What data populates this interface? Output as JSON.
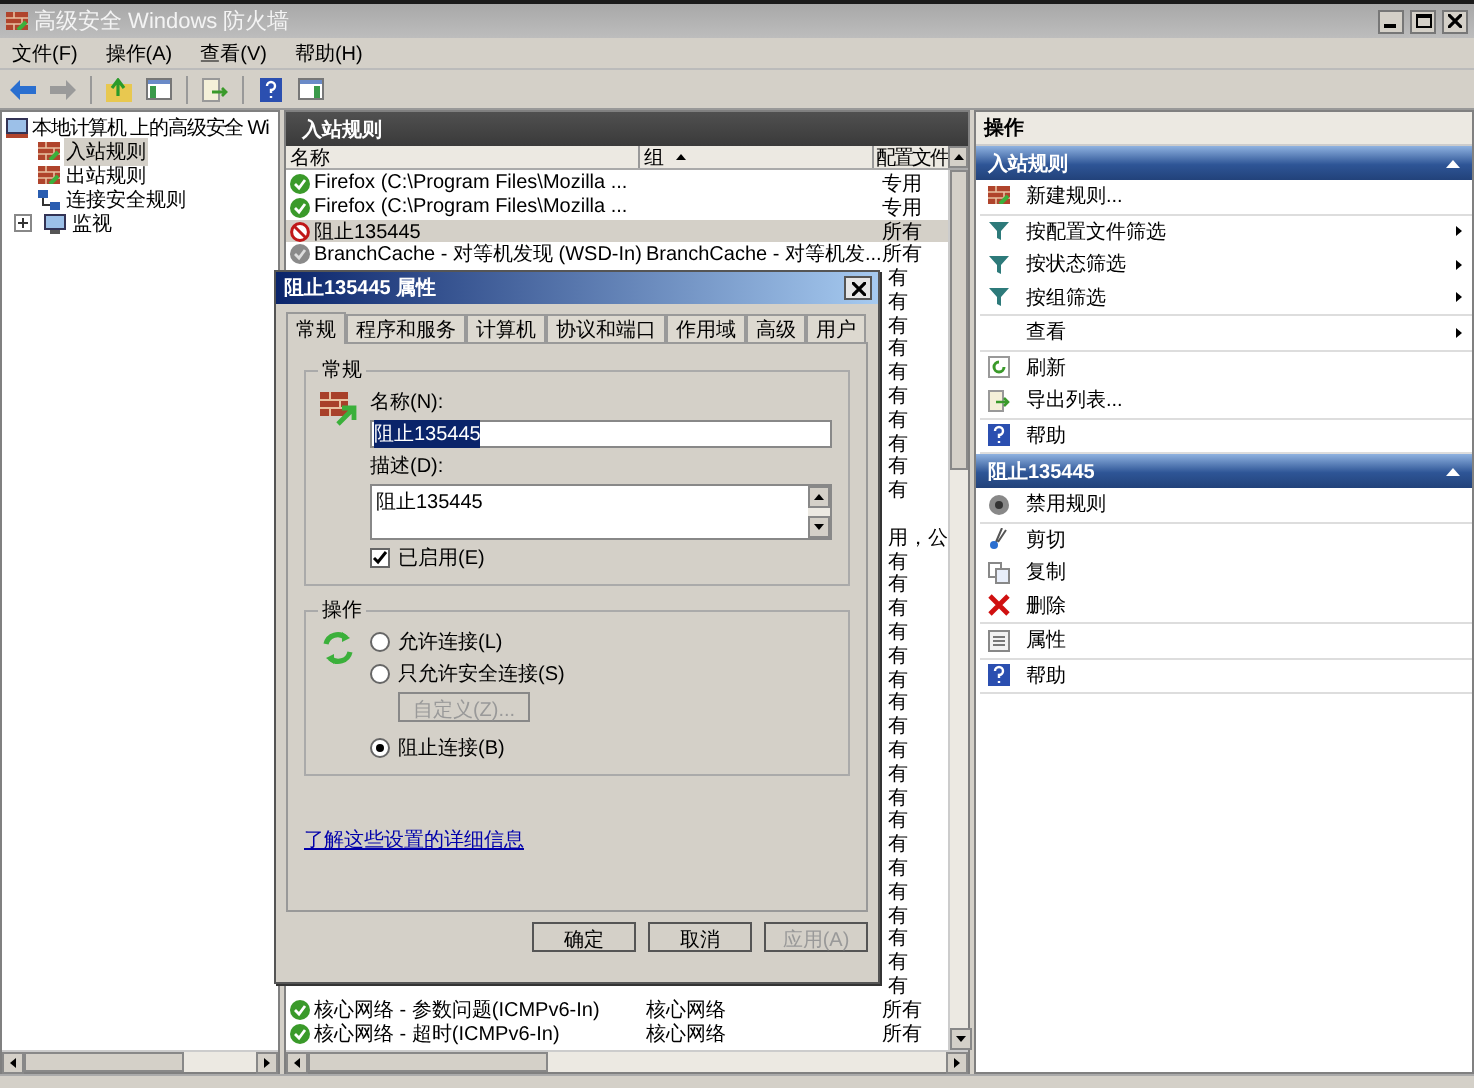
{
  "window": {
    "title": "高级安全 Windows 防火墙"
  },
  "menu": [
    "文件(F)",
    "操作(A)",
    "查看(V)",
    "帮助(H)"
  ],
  "tree": {
    "root": "本地计算机 上的高级安全 Wi",
    "children": [
      {
        "label": "入站规则",
        "selected": true,
        "kind": "inbound",
        "expander": false
      },
      {
        "label": "出站规则",
        "selected": false,
        "kind": "outbound",
        "expander": false
      },
      {
        "label": "连接安全规则",
        "selected": false,
        "kind": "security",
        "expander": false
      },
      {
        "label": "监视",
        "selected": false,
        "kind": "monitor",
        "expander": true
      }
    ]
  },
  "list": {
    "title": "入站规则",
    "columns": [
      {
        "label": "名称",
        "sorted": false
      },
      {
        "label": "组",
        "sorted": true
      },
      {
        "label": "配置文件",
        "sorted": false
      }
    ],
    "rows": [
      {
        "kind": "allow",
        "name": "Firefox (C:\\Program Files\\Mozilla ...",
        "profile": "专用",
        "selected": false
      },
      {
        "kind": "allow",
        "name": "Firefox (C:\\Program Files\\Mozilla ...",
        "profile": "专用",
        "selected": false
      },
      {
        "kind": "block",
        "name": "阻止135445",
        "profile": "所有",
        "selected": true
      },
      {
        "kind": "disabled",
        "name": "BranchCache - 对等机发现 (WSD-In)",
        "group": "BranchCache - 对等机发...",
        "profile": "所有",
        "selected": false
      },
      {
        "profile": "有"
      },
      {
        "profile": "有"
      },
      {
        "profile": "有"
      },
      {
        "profile": "有"
      },
      {
        "profile": "有"
      },
      {
        "profile": "有"
      },
      {
        "profile": "有"
      },
      {
        "profile": "有"
      },
      {
        "profile": "有"
      },
      {
        "profile": "有"
      },
      {},
      {
        "profile": "用，公"
      },
      {
        "profile": "有"
      },
      {
        "profile": "有"
      },
      {
        "profile": "有"
      },
      {
        "profile": "有"
      },
      {
        "profile": "有"
      },
      {
        "profile": "有"
      },
      {
        "profile": "有"
      },
      {
        "profile": "有"
      },
      {
        "profile": "有"
      },
      {
        "profile": "有"
      },
      {
        "profile": "有"
      },
      {
        "profile": "有"
      },
      {
        "profile": "有"
      },
      {
        "profile": "有"
      },
      {
        "profile": "有"
      },
      {
        "profile": "有"
      },
      {
        "profile": "有"
      },
      {
        "profile": "有"
      },
      {
        "profile": "有"
      },
      {
        "kind": "allow",
        "name": "核心网络 - 参数问题(ICMPv6-In)",
        "group": "核心网络",
        "profile": "所有",
        "selected": false
      },
      {
        "kind": "allow",
        "name": "核心网络 - 超时(ICMPv6-In)",
        "group": "核心网络",
        "profile": "所有",
        "selected": false
      }
    ]
  },
  "actions": {
    "title": "操作",
    "sections": [
      {
        "title": "入站规则",
        "groups": [
          [
            {
              "label": "新建规则...",
              "kind": "new-rule",
              "submenu": false
            }
          ],
          [
            {
              "label": "按配置文件筛选",
              "kind": "filter",
              "submenu": true
            },
            {
              "label": "按状态筛选",
              "kind": "filter",
              "submenu": true
            },
            {
              "label": "按组筛选",
              "kind": "filter",
              "submenu": true
            }
          ],
          [
            {
              "label": "查看",
              "kind": "plain",
              "submenu": true
            }
          ],
          [
            {
              "label": "刷新",
              "kind": "refresh",
              "submenu": false
            },
            {
              "label": "导出列表...",
              "kind": "export",
              "submenu": false
            }
          ],
          [
            {
              "label": "帮助",
              "kind": "help",
              "submenu": false
            }
          ]
        ]
      },
      {
        "title": "阻止135445",
        "groups": [
          [
            {
              "label": "禁用规则",
              "kind": "disable",
              "submenu": false
            }
          ],
          [
            {
              "label": "剪切",
              "kind": "cut",
              "submenu": false
            },
            {
              "label": "复制",
              "kind": "copy",
              "submenu": false
            },
            {
              "label": "删除",
              "kind": "delete",
              "submenu": false
            }
          ],
          [
            {
              "label": "属性",
              "kind": "properties",
              "submenu": false
            }
          ],
          [
            {
              "label": "帮助",
              "kind": "help",
              "submenu": false
            }
          ]
        ]
      }
    ]
  },
  "dialog": {
    "title": "阻止135445 属性",
    "tabs": [
      {
        "label": "常规",
        "selected": true
      },
      {
        "label": "程序和服务",
        "selected": false
      },
      {
        "label": "计算机",
        "selected": false
      },
      {
        "label": "协议和端口",
        "selected": false
      },
      {
        "label": "作用域",
        "selected": false
      },
      {
        "label": "高级",
        "selected": false
      },
      {
        "label": "用户",
        "selected": false
      }
    ],
    "general": {
      "legend": "常规",
      "name_label": "名称(N):",
      "name_value": "阻止135445",
      "desc_label": "描述(D):",
      "desc_value": "阻止135445",
      "enabled": {
        "label": "已启用(E)",
        "checked": true
      }
    },
    "action": {
      "legend": "操作",
      "options": [
        {
          "label": "允许连接(L)",
          "selected": false
        },
        {
          "label": "只允许安全连接(S)",
          "selected": false
        },
        {
          "label": "阻止连接(B)",
          "selected": true
        }
      ],
      "customize": {
        "label": "自定义(Z)...",
        "disabled": true
      }
    },
    "link": "了解这些设置的详细信息",
    "buttons": [
      {
        "label": "确定",
        "disabled": false
      },
      {
        "label": "取消",
        "disabled": false
      },
      {
        "label": "应用(A)",
        "disabled": true
      }
    ]
  }
}
